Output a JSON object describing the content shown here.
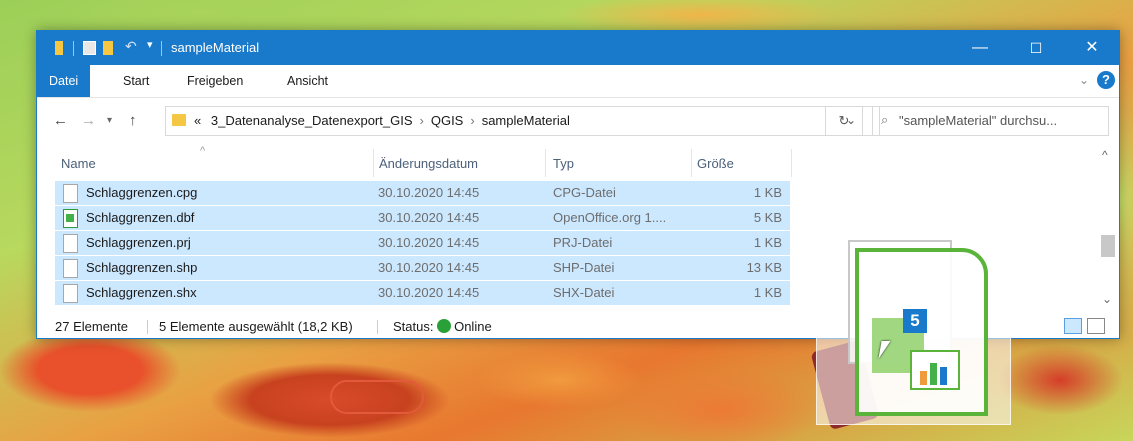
{
  "window": {
    "title": "sampleMaterial",
    "minimize": "—",
    "maximize": "☐",
    "close": "✕"
  },
  "ribbon": {
    "tabs": [
      "Datei",
      "Start",
      "Freigeben",
      "Ansicht"
    ],
    "help": "?"
  },
  "address": {
    "prefix": "«",
    "crumbs": [
      "3_Datenanalyse_Datenexport_GIS",
      "QGIS",
      "sampleMaterial"
    ],
    "search_placeholder": "\"sampleMaterial\" durchsu..."
  },
  "columns": {
    "name": "Name",
    "date": "Änderungsdatum",
    "type": "Typ",
    "size": "Größe"
  },
  "files": [
    {
      "name": "Schlaggrenzen.cpg",
      "date": "30.10.2020 14:45",
      "type": "CPG-Datei",
      "size": "1 KB",
      "icon": "file-icon"
    },
    {
      "name": "Schlaggrenzen.dbf",
      "date": "30.10.2020 14:45",
      "type": "OpenOffice.org 1....",
      "size": "5 KB",
      "icon": "calc-file-icon"
    },
    {
      "name": "Schlaggrenzen.prj",
      "date": "30.10.2020 14:45",
      "type": "PRJ-Datei",
      "size": "1 KB",
      "icon": "file-icon"
    },
    {
      "name": "Schlaggrenzen.shp",
      "date": "30.10.2020 14:45",
      "type": "SHP-Datei",
      "size": "13 KB",
      "icon": "file-icon"
    },
    {
      "name": "Schlaggrenzen.shx",
      "date": "30.10.2020 14:45",
      "type": "SHX-Datei",
      "size": "1 KB",
      "icon": "file-icon"
    }
  ],
  "status": {
    "count": "27 Elemente",
    "selected": "5 Elemente ausgewählt (18,2 KB)",
    "status_label": "Status:",
    "status_value": "Online"
  },
  "drag": {
    "count_badge": "5"
  },
  "colors": {
    "accent": "#1979ca",
    "selection": "#cce8ff",
    "online": "#2aa138"
  }
}
